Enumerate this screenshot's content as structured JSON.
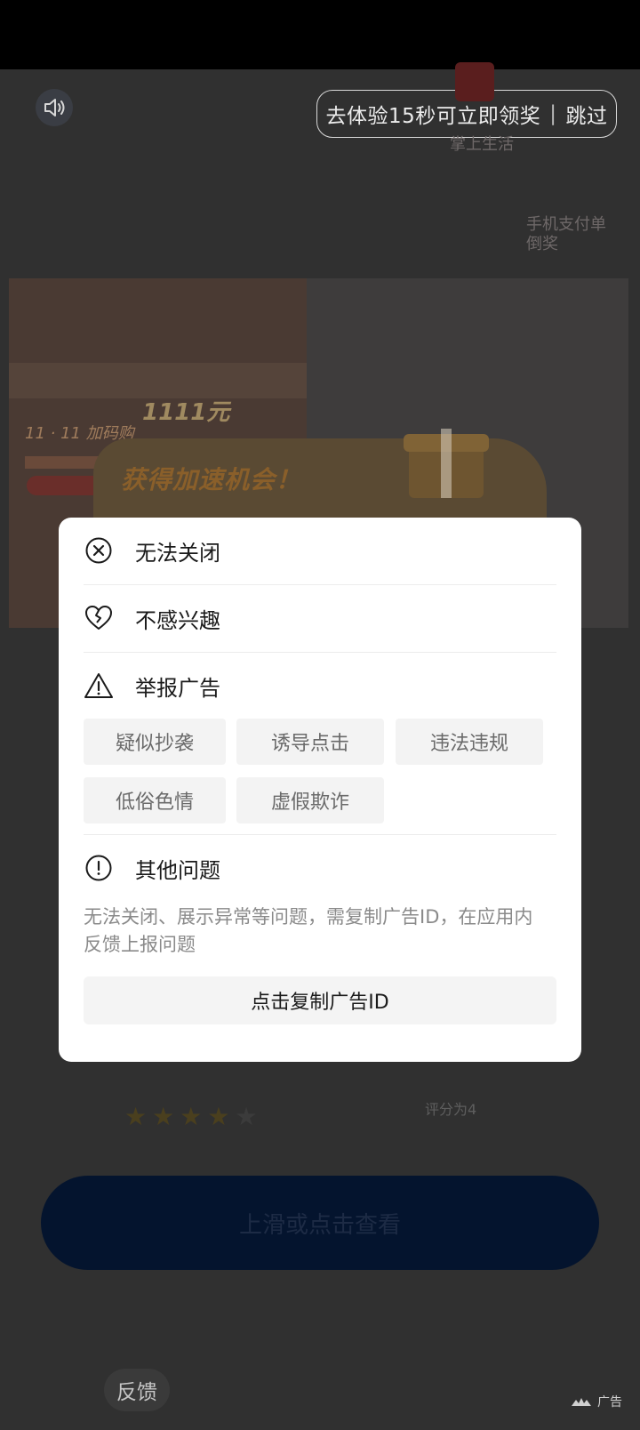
{
  "top_bar": {
    "skip_text": "去体验15秒可立即领奖",
    "skip_separator": "|",
    "skip_label": "跳过"
  },
  "ad": {
    "left_promo": "11 · 11 加码购",
    "amount": "1111元",
    "app_name": "掌上生活",
    "right_text": "手机支付单\n倒奖",
    "banner_title": "获得加速机会！",
    "rating_label": "评分为4",
    "rating_value": 4,
    "rating_max": 5,
    "cta_label": "上滑或点击查看",
    "feedback_label": "反馈",
    "ad_mark_label": "广告"
  },
  "dialog": {
    "options": [
      {
        "label": "无法关闭",
        "icon": "close-circle-icon"
      },
      {
        "label": "不感兴趣",
        "icon": "broken-heart-icon"
      },
      {
        "label": "举报广告",
        "icon": "warning-triangle-icon"
      }
    ],
    "report_tags": [
      "疑似抄袭",
      "诱导点击",
      "违法违规",
      "低俗色情",
      "虚假欺诈"
    ],
    "other": {
      "label": "其他问题",
      "icon": "exclamation-circle-icon",
      "description": "无法关闭、展示异常等问题，需复制广告ID，在应用内反馈上报问题",
      "copy_button": "点击复制广告ID"
    }
  },
  "colors": {
    "overlay_bg": "#2a2a2a",
    "dialog_bg": "#ffffff",
    "tag_bg": "#f3f3f3",
    "cta_bg": "#04142e"
  }
}
